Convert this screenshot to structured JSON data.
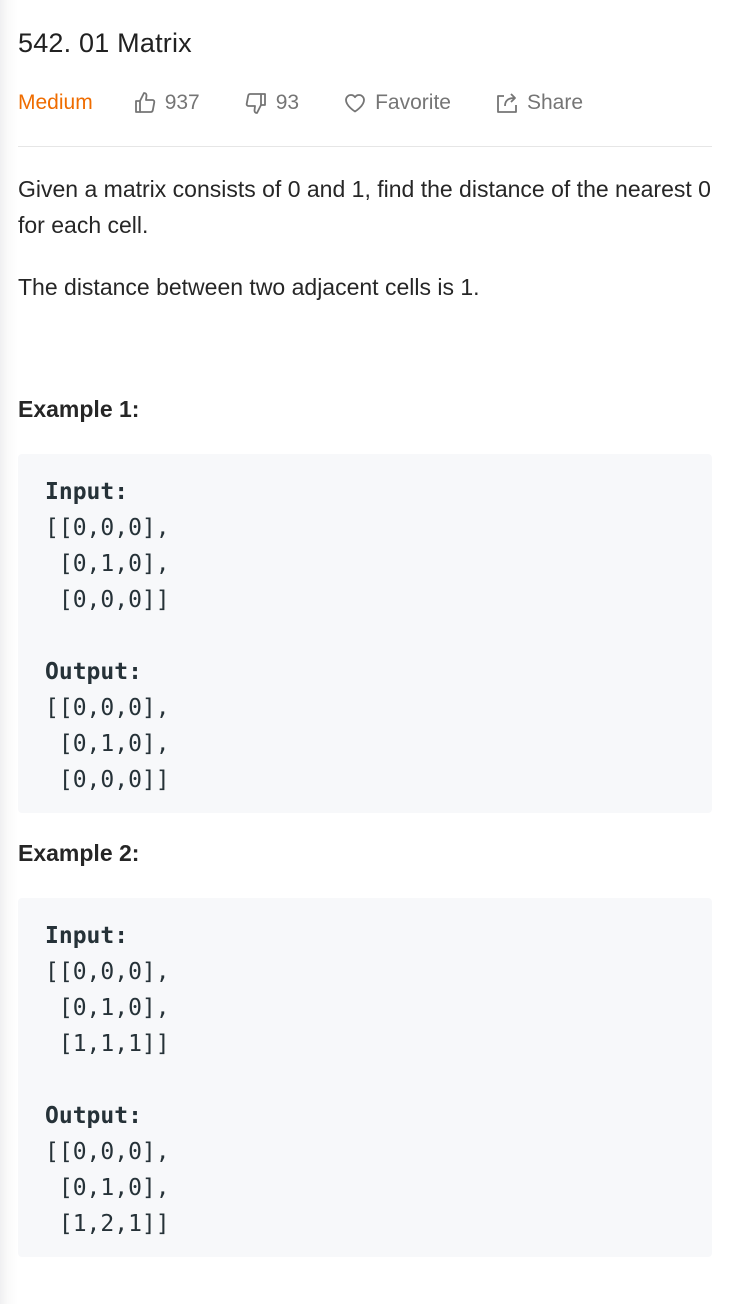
{
  "problem": {
    "title": "542. 01 Matrix",
    "difficulty": "Medium",
    "likes": "937",
    "dislikes": "93",
    "favorite_label": "Favorite",
    "share_label": "Share"
  },
  "description": {
    "p1": "Given a matrix consists of 0 and 1, find the distance of the nearest 0 for each cell.",
    "p2": "The distance between two adjacent cells is 1."
  },
  "examples": [
    {
      "title": "Example 1:",
      "input_label": "Input:",
      "input_lines": [
        "[[0,0,0],",
        " [0,1,0],",
        " [0,0,0]]"
      ],
      "output_label": "Output:",
      "output_lines": [
        "[[0,0,0],",
        " [0,1,0],",
        " [0,0,0]]"
      ]
    },
    {
      "title": "Example 2:",
      "input_label": "Input:",
      "input_lines": [
        "[[0,0,0],",
        " [0,1,0],",
        " [1,1,1]]"
      ],
      "output_label": "Output:",
      "output_lines": [
        "[[0,0,0],",
        " [0,1,0],",
        " [1,2,1]]"
      ]
    }
  ],
  "colors": {
    "difficulty_medium": "#ef6c00",
    "meta_text": "#757575",
    "code_bg": "#f7f8fa"
  },
  "icons": {
    "like": "thumbs-up-icon",
    "dislike": "thumbs-down-icon",
    "favorite": "heart-icon",
    "share": "share-icon"
  }
}
